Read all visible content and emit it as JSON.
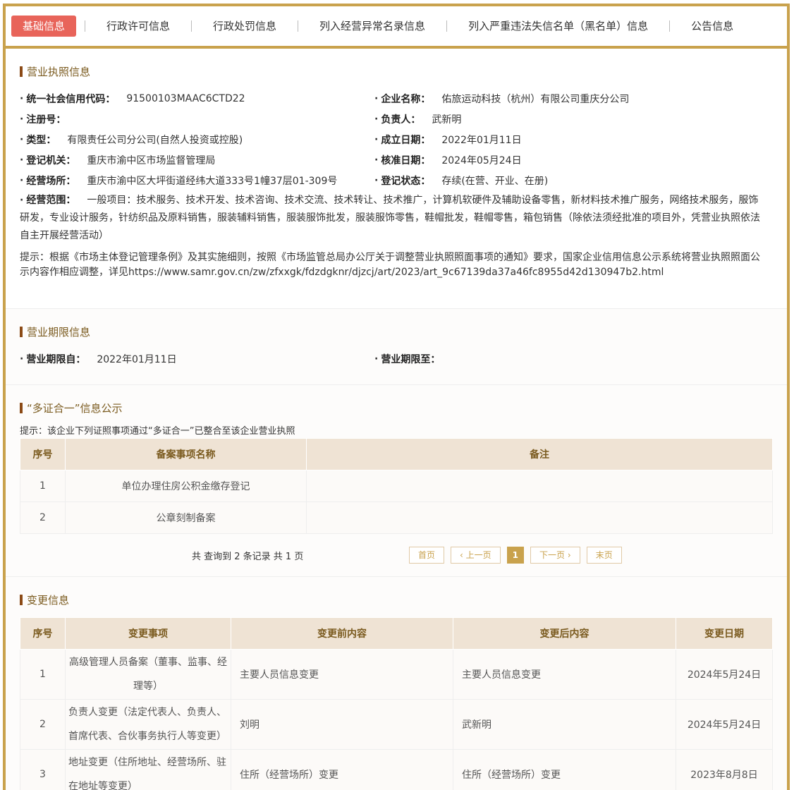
{
  "tabs": [
    {
      "label": "基础信息",
      "active": true
    },
    {
      "label": "行政许可信息",
      "active": false
    },
    {
      "label": "行政处罚信息",
      "active": false
    },
    {
      "label": "列入经营异常名录信息",
      "active": false
    },
    {
      "label": "列入严重违法失信名单（黑名单）信息",
      "active": false
    },
    {
      "label": "公告信息",
      "active": false
    }
  ],
  "license": {
    "title": "营业执照信息",
    "left": [
      {
        "label": "统一社会信用代码：",
        "value": "91500103MAAC6CTD22"
      },
      {
        "label": "注册号：",
        "value": ""
      },
      {
        "label": "类型：",
        "value": "有限责任公司分公司(自然人投资或控股)"
      },
      {
        "label": "登记机关：",
        "value": "重庆市渝中区市场监督管理局"
      },
      {
        "label": "经营场所：",
        "value": "重庆市渝中区大坪街道经纬大道333号1幢37层01-309号"
      }
    ],
    "right": [
      {
        "label": "企业名称：",
        "value": "佑旅运动科技（杭州）有限公司重庆分公司"
      },
      {
        "label": "负责人：",
        "value": "武新明"
      },
      {
        "label": "成立日期：",
        "value": "2022年01月11日"
      },
      {
        "label": "核准日期：",
        "value": "2024年05月24日"
      },
      {
        "label": "登记状态：",
        "value": "存续(在营、开业、在册)"
      }
    ],
    "scope_label": "经营范围：",
    "scope_value": "一般项目：技术服务、技术开发、技术咨询、技术交流、技术转让、技术推广，计算机软硬件及辅助设备零售，新材料技术推广服务，网络技术服务，服饰研发，专业设计服务，针纺织品及原料销售，服装辅料销售，服装服饰批发，服装服饰零售，鞋帽批发，鞋帽零售，箱包销售（除依法须经批准的项目外，凭营业执照依法自主开展经营活动）",
    "tip": "提示：根据《市场主体登记管理条例》及其实施细则，按照《市场监管总局办公厅关于调整营业执照照面事项的通知》要求，国家企业信用信息公示系统将营业执照照面公示内容作相应调整，详见https://www.samr.gov.cn/zw/zfxxgk/fdzdgknr/djzcj/art/2023/art_9c67139da37a46fc8955d42d130947b2.html"
  },
  "period": {
    "title": "营业期限信息",
    "from_label": "营业期限自：",
    "from_value": "2022年01月11日",
    "to_label": "营业期限至：",
    "to_value": ""
  },
  "multi_cert": {
    "title": "“多证合一”信息公示",
    "tip": "提示：该企业下列证照事项通过“多证合一”已整合至该企业营业执照",
    "headers": [
      "序号",
      "备案事项名称",
      "备注"
    ],
    "rows": [
      [
        "1",
        "单位办理住房公积金缴存登记",
        ""
      ],
      [
        "2",
        "公章刻制备案",
        ""
      ]
    ],
    "pager": {
      "count": "共 查询到 2 条记录 共 1 页",
      "first": "首页",
      "prev": "上一页",
      "current": "1",
      "next": "下一页",
      "last": "末页"
    }
  },
  "changes": {
    "title": "变更信息",
    "headers": [
      "序号",
      "变更事项",
      "变更前内容",
      "变更后内容",
      "变更日期"
    ],
    "rows": [
      [
        "1",
        "高级管理人员备案（董事、监事、经理等）",
        "主要人员信息变更",
        "主要人员信息变更",
        "2024年5月24日"
      ],
      [
        "2",
        "负责人变更（法定代表人、负责人、首席代表、合伙事务执行人等变更）",
        "刘明",
        "武新明",
        "2024年5月24日"
      ],
      [
        "3",
        "地址变更（住所地址、经营场所、驻在地址等变更）",
        "住所（经营场所）变更",
        "住所（经营场所）变更",
        "2023年8月8日"
      ]
    ]
  }
}
